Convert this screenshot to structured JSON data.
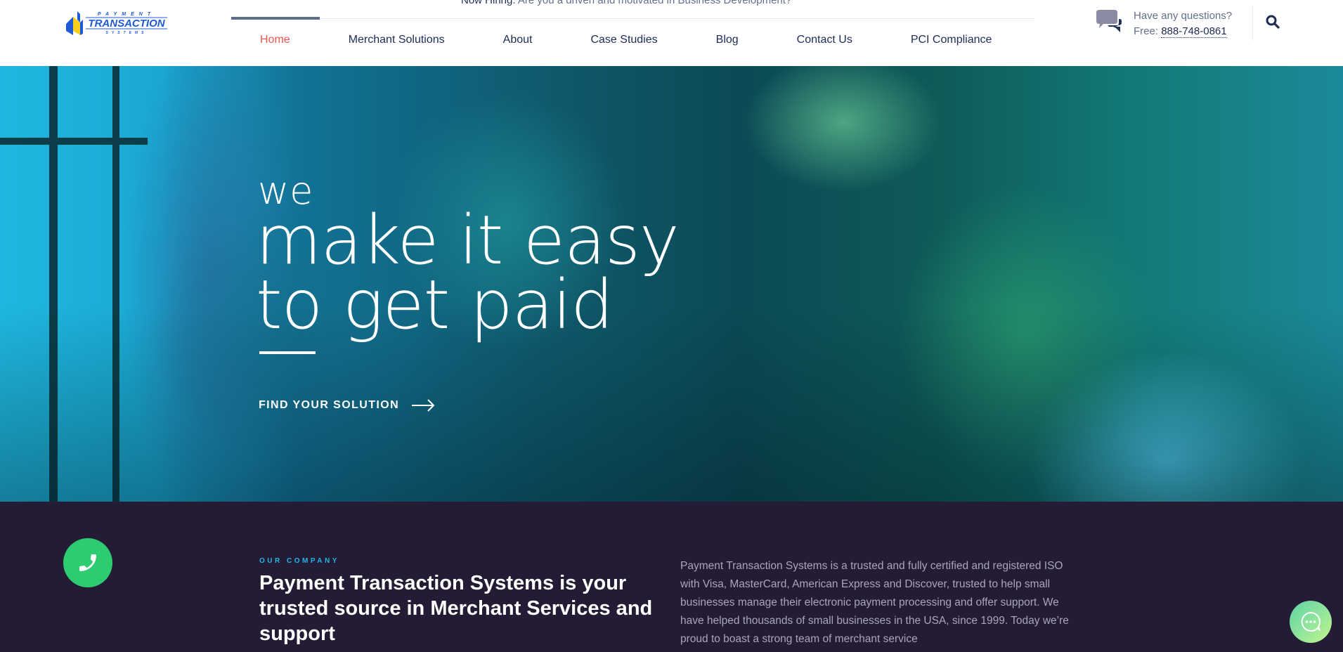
{
  "header": {
    "logo": {
      "top_text": "PAYMENT",
      "main_text": "TRANSACTION",
      "bottom_text": "SYSTEMS",
      "icon": "arrow-chevron-logo-icon"
    },
    "announcement": {
      "lead": "Now Hiring:",
      "text": "Are you a driven and motivated in Business Development?"
    },
    "nav": [
      {
        "label": "Home",
        "active": true
      },
      {
        "label": "Merchant Solutions",
        "active": false
      },
      {
        "label": "About",
        "active": false
      },
      {
        "label": "Case Studies",
        "active": false
      },
      {
        "label": "Blog",
        "active": false
      },
      {
        "label": "Contact Us",
        "active": false
      },
      {
        "label": "PCI Compliance",
        "active": false
      }
    ],
    "contact": {
      "question": "Have any questions?",
      "free_label": "Free:",
      "phone": "888-748-0861",
      "icon": "chat-bubbles-icon"
    },
    "search_icon": "search-icon"
  },
  "hero": {
    "line_small": "we",
    "line1": "make it easy",
    "line2": "to get paid",
    "cta_label": "FIND YOUR SOLUTION",
    "cta_icon": "arrow-right-icon"
  },
  "company": {
    "eyebrow": "OUR COMPANY",
    "title": "Payment Transaction Systems is your trusted source in Merchant Services and support",
    "body": "Payment Transaction Systems is a trusted and fully certified and registered ISO with Visa, MasterCard, American Express and Discover, trusted to help small businesses manage their electronic payment processing and offer support. We have helped thousands of small businesses in the USA, since 1999. Today we’re proud to boast a strong team of merchant service"
  },
  "floating": {
    "phone_icon": "phone-icon",
    "chat_icon": "chat-icon"
  },
  "colors": {
    "nav_active": "#f0544f",
    "nav_text": "#1e2c55",
    "accent_cyan": "#1fb7e6",
    "phone_green": "#2ecc71",
    "section_bg": "#231c34"
  }
}
